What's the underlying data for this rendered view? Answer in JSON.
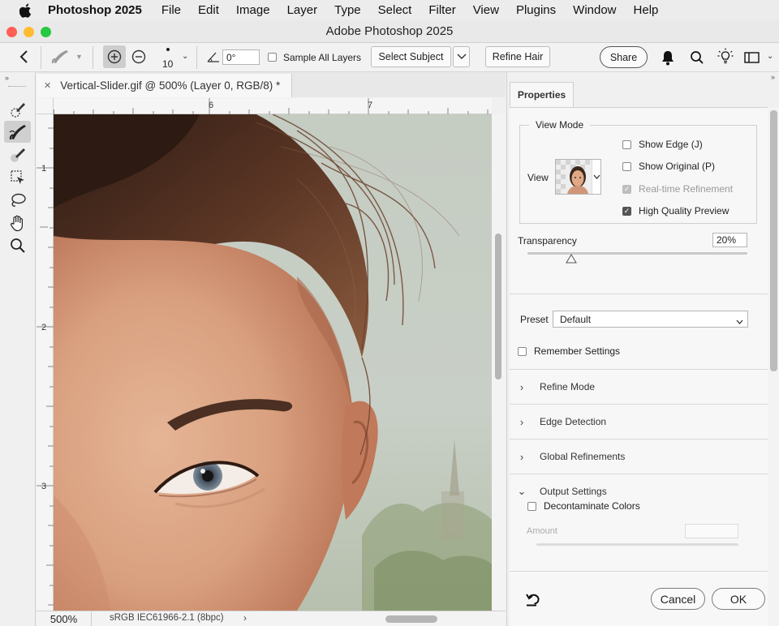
{
  "menubar": {
    "app": "Photoshop 2025",
    "items": [
      "File",
      "Edit",
      "Image",
      "Layer",
      "Type",
      "Select",
      "Filter",
      "View",
      "Plugins",
      "Window",
      "Help"
    ]
  },
  "window": {
    "title": "Adobe Photoshop 2025"
  },
  "options": {
    "brush_size": "10",
    "angle": "0°",
    "sample_all_layers": "Sample All Layers",
    "select_subject": "Select Subject",
    "refine_hair": "Refine Hair",
    "share": "Share"
  },
  "document": {
    "tab_title": "Vertical-Slider.gif @ 500% (Layer 0, RGB/8) *",
    "ruler_h": [
      "6",
      "7"
    ],
    "ruler_v": [
      "1",
      "2",
      "3"
    ],
    "zoom": "500%",
    "color_profile": "sRGB IEC61966-2.1 (8bpc)"
  },
  "properties": {
    "tab": "Properties",
    "view_mode_label": "View Mode",
    "view_label": "View",
    "show_edge": "Show Edge (J)",
    "show_original": "Show Original (P)",
    "realtime_refinement": "Real-time Refinement",
    "high_quality_preview": "High Quality Preview",
    "transparency_label": "Transparency",
    "transparency_value": "20%",
    "transparency_fraction": 0.2,
    "preset_label": "Preset",
    "preset_value": "Default",
    "remember_settings": "Remember Settings",
    "sections": [
      "Refine Mode",
      "Edge Detection",
      "Global Refinements"
    ],
    "output_settings": "Output Settings",
    "decontaminate_colors": "Decontaminate Colors",
    "amount_label": "Amount",
    "cancel": "Cancel",
    "ok": "OK"
  },
  "colors": {
    "close": "#ff5f57",
    "minimize": "#febc2e",
    "zoom": "#28c840"
  }
}
